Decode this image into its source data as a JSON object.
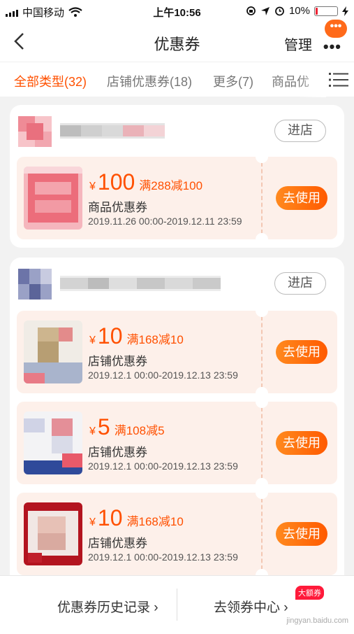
{
  "status_bar": {
    "carrier": "中国移动",
    "time": "上午10:56",
    "battery": "10%"
  },
  "nav": {
    "title": "优惠券",
    "manage": "管理",
    "more": "•••",
    "bubble": "•••"
  },
  "tabs": [
    {
      "label": "全部类型(32)",
      "active": true
    },
    {
      "label": "店铺优惠券(18)",
      "active": false
    },
    {
      "label": "更多(7)",
      "active": false
    },
    {
      "label": "商品优",
      "active": false
    }
  ],
  "stores": [
    {
      "enter_label": "进店",
      "coupons": [
        {
          "currency": "¥",
          "amount": "100",
          "condition": "满288减100",
          "type": "商品优惠券",
          "period": "2019.11.26 00:00-2019.12.11 23:59",
          "use_label": "去使用"
        }
      ]
    },
    {
      "enter_label": "进店",
      "coupons": [
        {
          "currency": "¥",
          "amount": "10",
          "condition": "满168减10",
          "type": "店铺优惠券",
          "period": "2019.12.1 00:00-2019.12.13 23:59",
          "use_label": "去使用"
        },
        {
          "currency": "¥",
          "amount": "5",
          "condition": "满108减5",
          "type": "店铺优惠券",
          "period": "2019.12.1 00:00-2019.12.13 23:59",
          "use_label": "去使用"
        },
        {
          "currency": "¥",
          "amount": "10",
          "condition": "满168减10",
          "type": "店铺优惠券",
          "period": "2019.12.1 00:00-2019.12.13 23:59",
          "use_label": "去使用"
        }
      ]
    }
  ],
  "bottom": {
    "history": "优惠券历史记录 ›",
    "center": "去领券中心 ›",
    "badge": "大额券",
    "watermark": "jingyan.baidu.com"
  },
  "colors": {
    "accent": "#ff5000",
    "coupon_bg": "#fdf0ea"
  }
}
